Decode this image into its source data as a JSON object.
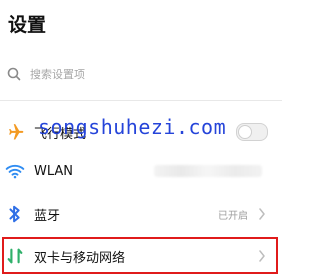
{
  "header": {
    "title": "设置"
  },
  "search": {
    "placeholder": "搜索设置项"
  },
  "settings": [
    {
      "label": "飞行模式",
      "icon": "airplane-icon",
      "control": "toggle",
      "enabled": false
    },
    {
      "label": "WLAN",
      "icon": "wifi-icon"
    },
    {
      "label": "蓝牙",
      "icon": "bluetooth-icon",
      "status": "已开启"
    },
    {
      "label": "双卡与移动网络",
      "icon": "dual-sim-icon"
    }
  ],
  "watermark": {
    "text": "songshuhezi.com"
  },
  "colors": {
    "airplane": "#F39A22",
    "wifi": "#2F8CF2",
    "bluetooth": "#2F6FE6",
    "dual_sim": "#2FB06A",
    "highlight": "#E01B1B",
    "watermark": "#1A3BD8"
  }
}
